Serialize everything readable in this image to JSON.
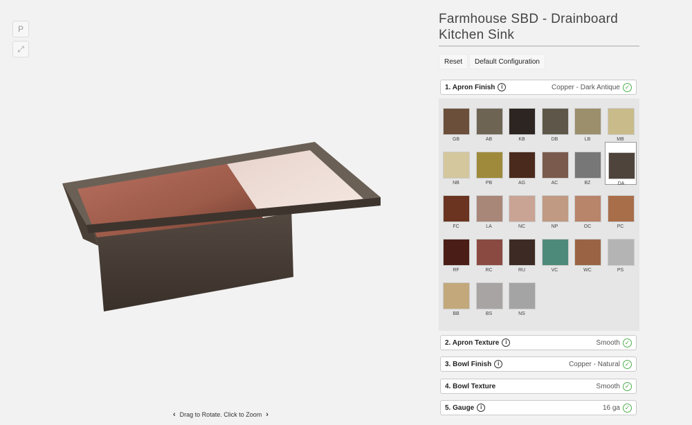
{
  "viewer": {
    "pin_icon": "pinterest-icon",
    "expand_icon": "expand-icon",
    "hint": "Drag to Rotate. Click to Zoom"
  },
  "panel": {
    "title_line1": "Farmhouse SBD - Drainboard",
    "title_line2": "Kitchen Sink",
    "reset_label": "Reset",
    "default_label": "Default Configuration",
    "sections": [
      {
        "label": "1.  Apron Finish",
        "value": "Copper - Dark Antique",
        "has_info": true
      },
      {
        "label": "2.  Apron Texture",
        "value": "Smooth",
        "has_info": true
      },
      {
        "label": "3.  Bowl Finish",
        "value": "Copper - Natural",
        "has_info": true
      },
      {
        "label": "4.  Bowl Texture",
        "value": "Smooth",
        "has_info": false
      },
      {
        "label": "5.  Gauge",
        "value": "16 ga",
        "has_info": true
      }
    ],
    "selected_swatch": "DA",
    "swatches": [
      {
        "code": "GB",
        "color": "#6b4f3a"
      },
      {
        "code": "AB",
        "color": "#6e6454"
      },
      {
        "code": "KB",
        "color": "#2c2522"
      },
      {
        "code": "DB",
        "color": "#5e5749"
      },
      {
        "code": "LB",
        "color": "#9c8f6c"
      },
      {
        "code": "MB",
        "color": "#c9bb8a"
      },
      {
        "code": "NB",
        "color": "#d4c79e"
      },
      {
        "code": "PB",
        "color": "#9e8a3a"
      },
      {
        "code": "AG",
        "color": "#4a2a1c"
      },
      {
        "code": "AC",
        "color": "#7a5a4c"
      },
      {
        "code": "BZ",
        "color": "#777777"
      },
      {
        "code": "DA",
        "color": "#4f443c"
      },
      {
        "code": "FC",
        "color": "#6a3420"
      },
      {
        "code": "LA",
        "color": "#a88678"
      },
      {
        "code": "NC",
        "color": "#c9a495"
      },
      {
        "code": "NP",
        "color": "#c09a82"
      },
      {
        "code": "OC",
        "color": "#b8846a"
      },
      {
        "code": "PC",
        "color": "#a86e4a"
      },
      {
        "code": "RF",
        "color": "#4a1e16"
      },
      {
        "code": "RC",
        "color": "#8a4a42"
      },
      {
        "code": "RU",
        "color": "#3e2a24"
      },
      {
        "code": "VC",
        "color": "#4e8a7a"
      },
      {
        "code": "WC",
        "color": "#9a6444"
      },
      {
        "code": "PS",
        "color": "#b4b4b4"
      },
      {
        "code": "BB",
        "color": "#c2a87a"
      },
      {
        "code": "BS",
        "color": "#a8a4a4"
      },
      {
        "code": "NS",
        "color": "#a4a4a4"
      }
    ]
  }
}
